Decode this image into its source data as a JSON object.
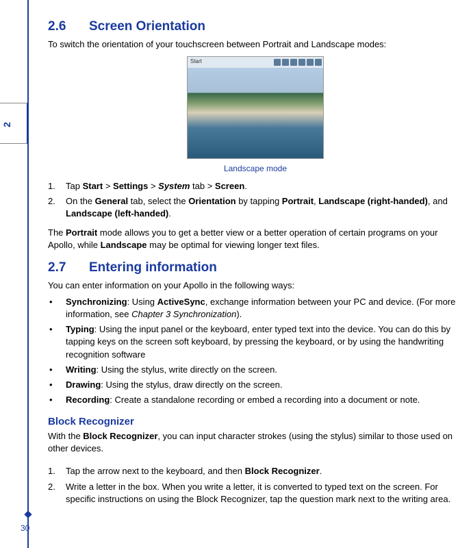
{
  "page": {
    "number": "30",
    "tab_num": "2"
  },
  "section_2_6": {
    "number": "2.6",
    "title": "Screen Orientation",
    "intro": "To switch the orientation of your touchscreen between Portrait and Landscape modes:",
    "caption": "Landscape mode",
    "step1": {
      "t1": "Tap ",
      "b1": "Start",
      "t2": " > ",
      "b2": "Settings",
      "t3": " > ",
      "bi1": "System",
      "t4": " tab > ",
      "b3": "Screen",
      "t5": "."
    },
    "step2": {
      "t1": "On the ",
      "b1": "General",
      "t2": " tab, select the ",
      "b2": "Orientation",
      "t3": " by tapping ",
      "b3": "Portrait",
      "t4": ", ",
      "b4": "Landscape (right-handed)",
      "t5": ", and ",
      "b5": "Landscape (left-handed)",
      "t6": "."
    },
    "para1": {
      "t1": "The ",
      "b1": "Portrait",
      "t2": " mode allows you to get a better view or a better operation of certain programs on your Apollo, while ",
      "b2": "Landscape",
      "t3": " may be optimal for viewing longer text files."
    }
  },
  "section_2_7": {
    "number": "2.7",
    "title": "Entering information",
    "intro": "You can enter information on your Apollo in the following ways:",
    "items": {
      "sync": {
        "b1": "Synchronizing",
        "t1": ": Using ",
        "b2": "ActiveSync",
        "t2": ", exchange information between your PC and device. (For more information, see ",
        "i1": "Chapter 3 Synchronization",
        "t3": ")."
      },
      "typing": {
        "b1": "Typing",
        "t1": ": Using the input panel or the keyboard, enter typed text into the device. You can do this by tapping keys on the screen soft keyboard, by pressing the keyboard, or by using the handwriting recognition software"
      },
      "writing": {
        "b1": "Writing",
        "t1": ": Using the stylus, write directly on the screen."
      },
      "drawing": {
        "b1": "Drawing",
        "t1": ": Using the stylus, draw directly on the screen."
      },
      "recording": {
        "b1": "Recording",
        "t1": ": Create a standalone recording or embed a recording into a document or note."
      }
    }
  },
  "block_recognizer": {
    "title": "Block Recognizer",
    "para": {
      "t1": "With the ",
      "b1": "Block Recognizer",
      "t2": ", you can input character strokes (using the stylus) similar to those used on other devices."
    },
    "step1": {
      "t1": "Tap the arrow next to the keyboard, and then ",
      "b1": "Block Recognizer",
      "t2": "."
    },
    "step2": {
      "t1": "Write a letter in the box. When you write a letter, it is converted to typed text on the screen. For specific instructions on using the Block Recognizer, tap the question mark next to the writing area."
    }
  }
}
